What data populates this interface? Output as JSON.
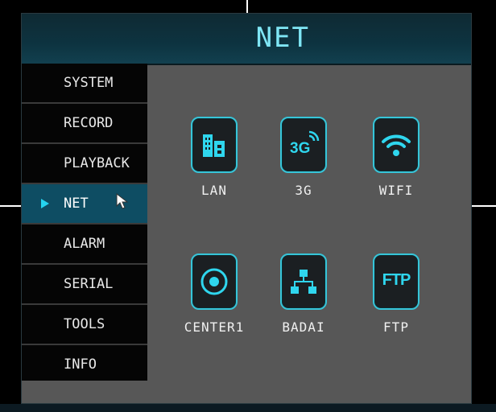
{
  "window": {
    "title": "NET"
  },
  "sidebar": {
    "items": [
      {
        "label": "SYSTEM",
        "active": false
      },
      {
        "label": "RECORD",
        "active": false
      },
      {
        "label": "PLAYBACK",
        "active": false
      },
      {
        "label": "NET",
        "active": true
      },
      {
        "label": "ALARM",
        "active": false
      },
      {
        "label": "SERIAL",
        "active": false
      },
      {
        "label": "TOOLS",
        "active": false
      },
      {
        "label": "INFO",
        "active": false
      }
    ]
  },
  "net_options": [
    {
      "label": "LAN",
      "icon": "lan-icon"
    },
    {
      "label": "3G",
      "icon": "3g-icon"
    },
    {
      "label": "WIFI",
      "icon": "wifi-icon"
    },
    {
      "label": "CENTER1",
      "icon": "center-icon"
    },
    {
      "label": "BADAI",
      "icon": "network-tree-icon"
    },
    {
      "label": "FTP",
      "icon": "ftp-icon"
    }
  ],
  "icons": {
    "3g_text": "3G",
    "ftp_text": "FTP"
  },
  "colors": {
    "accent": "#37c5d9",
    "active_bg": "#0e4d63",
    "title_text": "#7fe6f5",
    "panel_bg": "#575757"
  }
}
